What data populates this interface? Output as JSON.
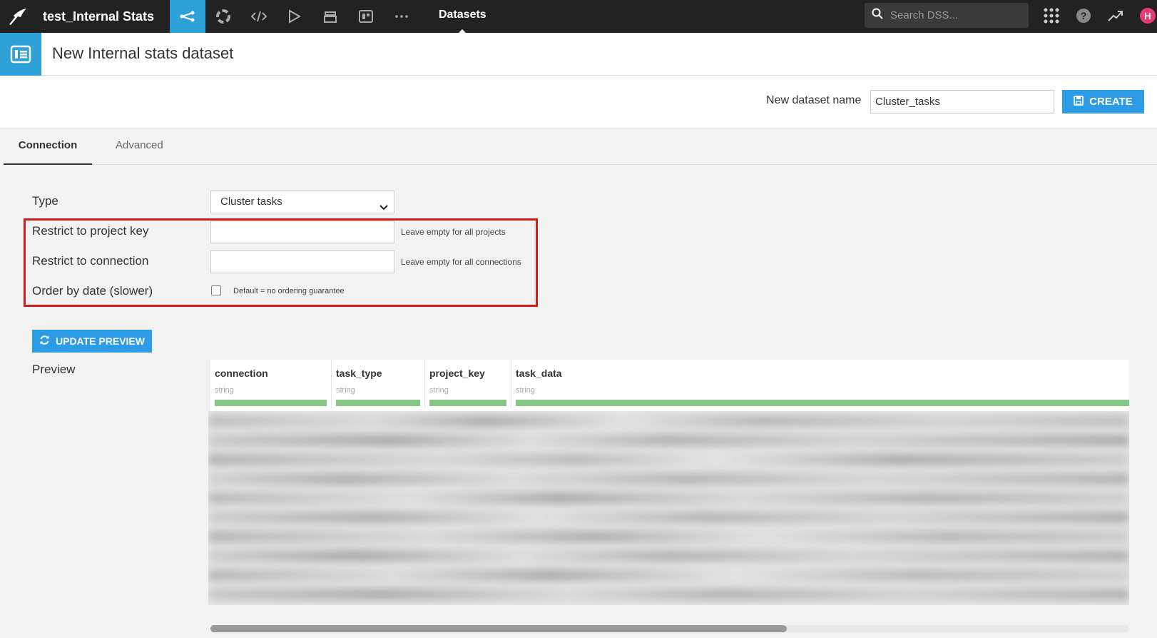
{
  "topbar": {
    "project_title": "test_Internal Stats",
    "nav_items": [
      "flow-icon",
      "lab-icon",
      "code-icon",
      "run-icon",
      "stack-icon",
      "dashboard-icon",
      "more-icon"
    ],
    "current_section": "Datasets",
    "search_placeholder": "Search DSS...",
    "avatar_initial": "H"
  },
  "header": {
    "title": "New Internal stats dataset"
  },
  "name_row": {
    "label": "New dataset name",
    "value": "Cluster_tasks",
    "create_label": "CREATE"
  },
  "tabs": {
    "connection": "Connection",
    "advanced": "Advanced"
  },
  "form": {
    "type_label": "Type",
    "type_value": "Cluster tasks",
    "project_key_label": "Restrict to project key",
    "project_key_help": "Leave empty for all projects",
    "connection_label": "Restrict to connection",
    "connection_help": "Leave empty for all connections",
    "order_label": "Order by date (slower)",
    "order_help": "Default = no ordering guarantee",
    "order_checked": false
  },
  "preview": {
    "update_label": "UPDATE PREVIEW",
    "label": "Preview",
    "columns": [
      {
        "name": "connection",
        "type": "string"
      },
      {
        "name": "task_type",
        "type": "string"
      },
      {
        "name": "project_key",
        "type": "string"
      },
      {
        "name": "task_data",
        "type": "string"
      }
    ]
  },
  "colors": {
    "accent": "#2ea1d9",
    "button": "#2d9be5",
    "highlight": "#d41a1a",
    "validity_bar": "#84c784",
    "topbar": "#222222"
  }
}
